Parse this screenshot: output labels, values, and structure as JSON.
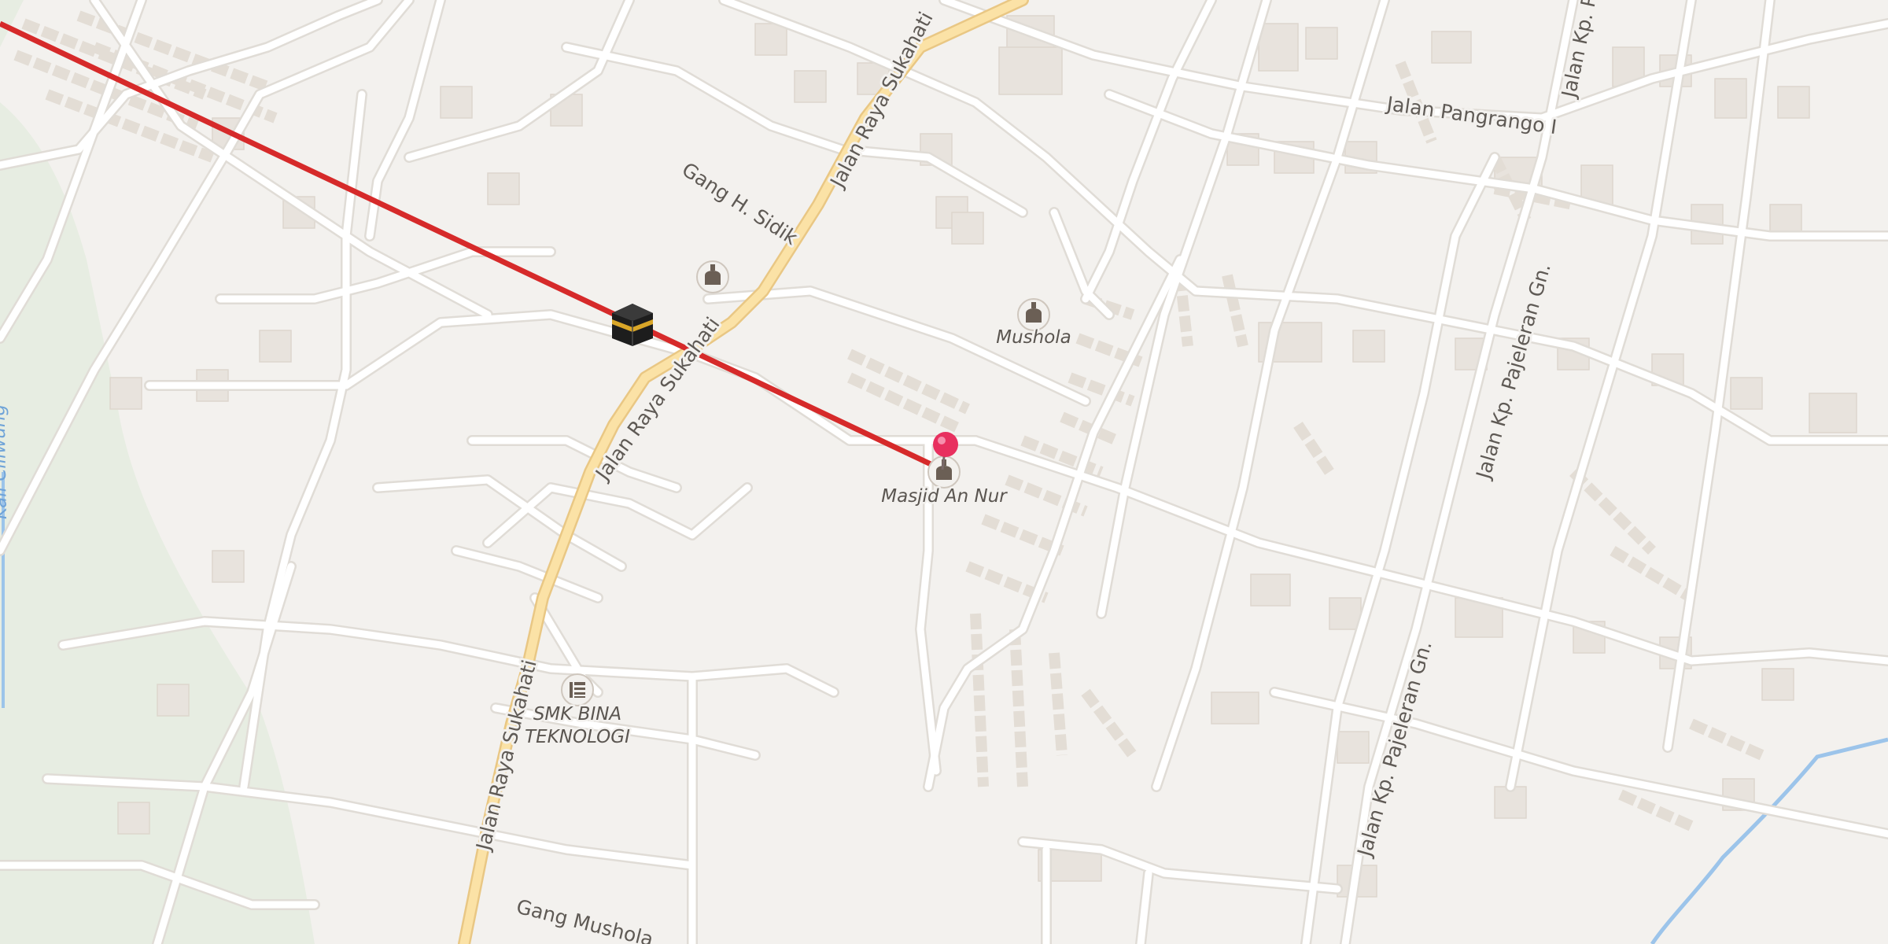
{
  "map": {
    "colors": {
      "background": "#f3f1ee",
      "green_area": "#e4ecdf",
      "minor_road": "#ffffff",
      "minor_road_casing": "#e0dcd6",
      "main_road": "#fbe2a6",
      "main_road_casing": "#e9c784",
      "building": "#e8e3dd",
      "building_edge": "#ddd6cd",
      "route_line": "#d62a2a",
      "pin": "#e8305f",
      "water": "#9cc4ea"
    },
    "road_labels": {
      "jalan_raya_sukahati_top": "Jalan Raya Sukahati",
      "jalan_raya_sukahati_mid": "Jalan Raya Sukahati",
      "jalan_raya_sukahati_bottom": "Jalan Raya Sukahati",
      "gang_h_sidik": "Gang H. Sidik",
      "jalan_pangrango": "Jalan Pangrango I",
      "jalan_kp_top": "Jalan Kp. P",
      "pajeleran_upper": "Jalan Kp. Pajeleran Gn.",
      "pajeleran_lower": "Jalan Kp. Pajeleran Gn.",
      "gang_mushola": "Gang Mushola"
    },
    "water_label": "Kali Ciliwung",
    "pois": {
      "mushola": "Mushola",
      "masjid": "Masjid An Nur",
      "school_line1": "SMK BINA",
      "school_line2": "TEKNOLOGI"
    },
    "icons": {
      "kaaba": "kaaba-icon",
      "mosque": "mosque-icon",
      "school": "school-icon",
      "pin": "location-pin-icon"
    }
  }
}
